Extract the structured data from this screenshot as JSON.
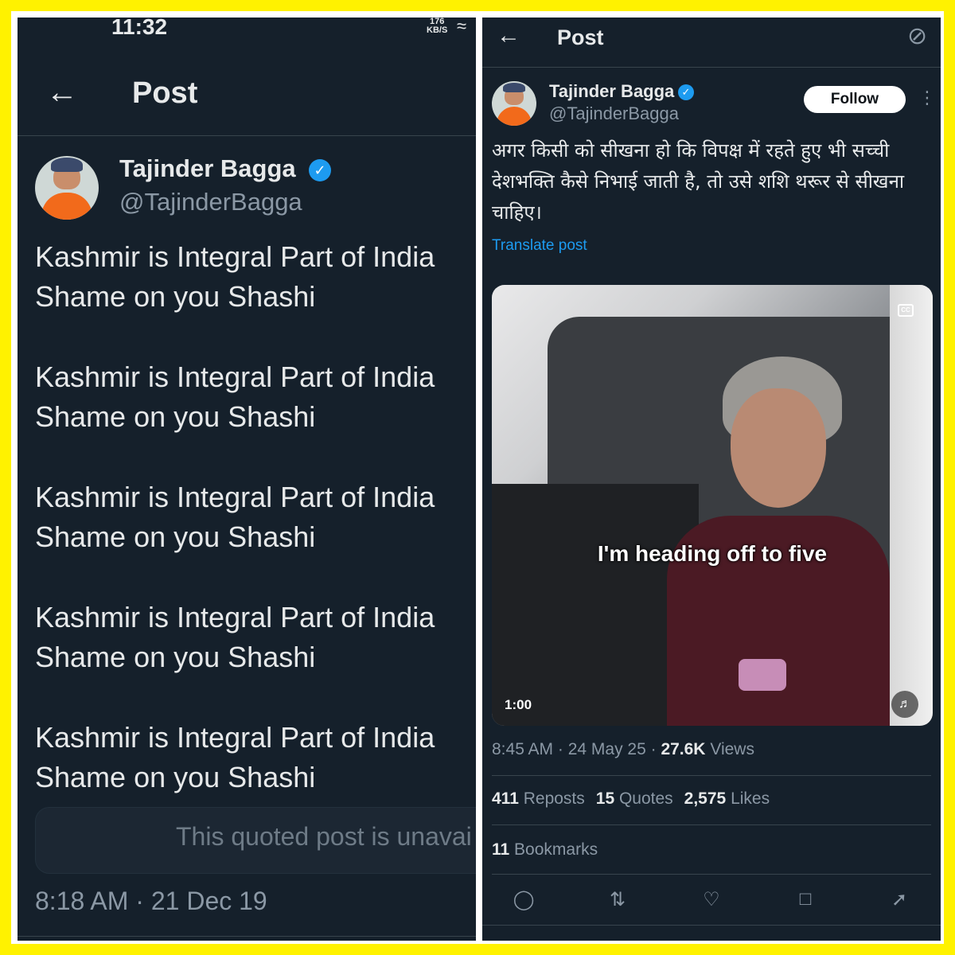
{
  "left": {
    "status": {
      "time": "11:32",
      "speed_value": "176",
      "speed_unit": "KB/S"
    },
    "header": {
      "title": "Post"
    },
    "author": {
      "name": "Tajinder Bagga",
      "handle": "@TajinderBagga"
    },
    "body_lines": [
      "Kashmir is Integral Part of India",
      "Shame on you Shashi",
      "Kashmir is Integral Part of India",
      "Shame on you Shashi",
      "Kashmir is Integral Part of India",
      "Shame on you Shashi",
      "Kashmir is Integral Part of India",
      "Shame on you Shashi",
      "Kashmir is Integral Part of India",
      "Shame on you Shashi"
    ],
    "quote_text": "This quoted post is unavai",
    "timestamp": "8:18 AM · 21 Dec 19"
  },
  "right": {
    "header": {
      "title": "Post"
    },
    "author": {
      "name": "Tajinder Bagga",
      "handle": "@TajinderBagga"
    },
    "follow_label": "Follow",
    "body": "अगर किसी को सीखना हो कि विपक्ष में रहते हुए भी सच्ची देशभक्ति कैसे निभाई जाती है, तो उसे शशि थरूर से सीखना चाहिए।",
    "translate_label": "Translate post",
    "video": {
      "caption": "I'm heading off to five",
      "cc": "CC",
      "duration": "1:00"
    },
    "meta": {
      "time_date": "8:45 AM · 24 May 25 · ",
      "views_count": "27.6K",
      "views_label": " Views"
    },
    "stats": {
      "reposts_count": "411",
      "reposts_label": " Reposts",
      "quotes_count": "15",
      "quotes_label": " Quotes",
      "likes_count": "2,575",
      "likes_label": " Likes",
      "bookmarks_count": "11",
      "bookmarks_label": " Bookmarks"
    }
  },
  "icons": {
    "back": "arrow-left",
    "verified": "verified-badge",
    "grok": "grok-icon",
    "more": "more-vertical",
    "reply": "reply-icon",
    "repost": "repost-icon",
    "like": "heart-icon",
    "bookmark": "bookmark-icon",
    "share": "share-icon",
    "volume": "volume-icon"
  },
  "colors": {
    "border": "#fff200",
    "background": "#15202b",
    "accent": "#1d9bf0",
    "muted": "#8b98a5"
  }
}
